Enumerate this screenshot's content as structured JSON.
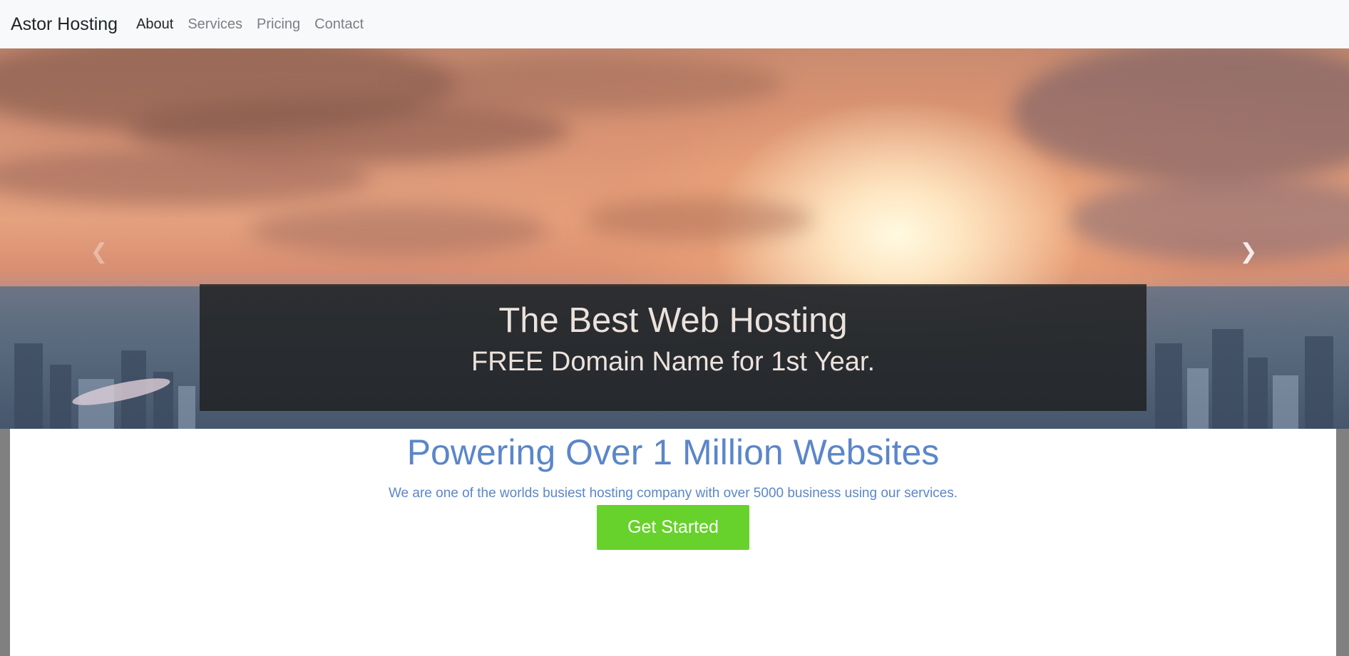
{
  "navbar": {
    "brand": "Astor Hosting",
    "links": [
      {
        "label": "About",
        "active": true
      },
      {
        "label": "Services",
        "active": false
      },
      {
        "label": "Pricing",
        "active": false
      },
      {
        "label": "Contact",
        "active": false
      }
    ]
  },
  "hero": {
    "title": "The Best Web Hosting",
    "subtitle": "FREE Domain Name for 1st Year.",
    "prev_icon": "chevron-left-icon",
    "next_icon": "chevron-right-icon"
  },
  "main": {
    "headline": "Powering Over 1 Million Websites",
    "description": "We are one of the worlds busiest hosting company with over 5000 business using our services.",
    "cta_label": "Get Started"
  },
  "colors": {
    "navbar_bg": "#f8f9fa",
    "accent_blue": "#5b86c9",
    "cta_green": "#68d22c",
    "caption_bg": "#1e1e1e",
    "gutter": "#808080"
  }
}
